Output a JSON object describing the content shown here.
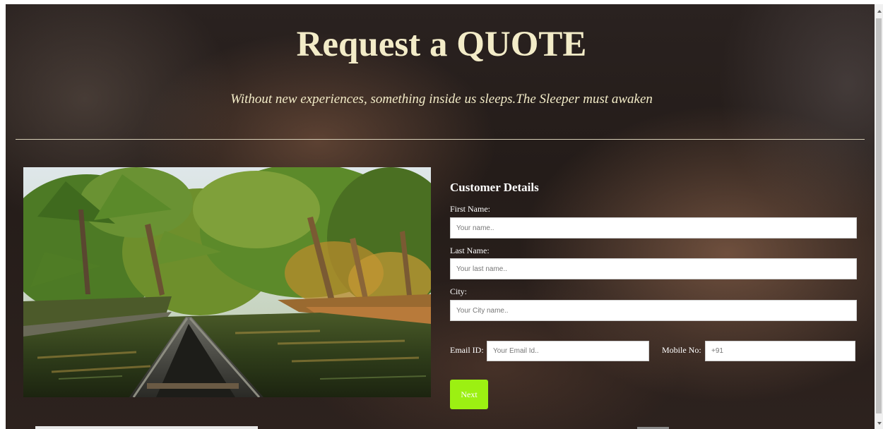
{
  "header": {
    "title": "Request a QUOTE",
    "tagline": "Without new experiences, something inside us sleeps.The Sleeper must awaken"
  },
  "form": {
    "heading": "Customer Details",
    "first_name": {
      "label": "First Name:",
      "placeholder": "Your name.."
    },
    "last_name": {
      "label": "Last Name:",
      "placeholder": "Your last name.."
    },
    "city": {
      "label": "City:",
      "placeholder": "Your City name.."
    },
    "email": {
      "label": "Email ID:",
      "placeholder": "Your Email Id.."
    },
    "mobile": {
      "label": "Mobile No:",
      "placeholder": "+91"
    },
    "next_label": "Next"
  },
  "colors": {
    "heading_text": "#f3ecc8",
    "button_accent": "#9cf012"
  },
  "icons": {
    "scroll_up": "chevron-up-icon",
    "scroll_down": "chevron-down-icon"
  }
}
